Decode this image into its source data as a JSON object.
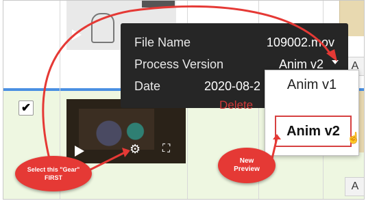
{
  "tooltip": {
    "file_name_label": "File Name",
    "file_name_value": "109002.mov",
    "process_version_label": "Process Version",
    "process_version_value": "Anim v2",
    "date_label": "Date",
    "date_value": "2020-08-2",
    "delete_label": "Delete"
  },
  "dropdown": {
    "options": [
      "Anim v1",
      "Anim v2"
    ]
  },
  "grid": {
    "right_cell_letter": "A",
    "checkbox_mark": "✔"
  },
  "callouts": {
    "left_line1": "Select this \"Gear\"",
    "left_line2": "FIRST",
    "right_line1": "New",
    "right_line2": "Preview"
  },
  "icons": {
    "gear": "gear-icon",
    "fullscreen": "fullscreen-icon",
    "play": "play-icon",
    "caret": "caret-down-icon",
    "hand_cursor": "hand-cursor-icon"
  },
  "colors": {
    "selection_line": "#4a90e2",
    "selected_row_bg": "#eef7e1",
    "tooltip_bg": "#262626",
    "delete_text": "#d23a3a",
    "callout_red": "#e53935"
  }
}
